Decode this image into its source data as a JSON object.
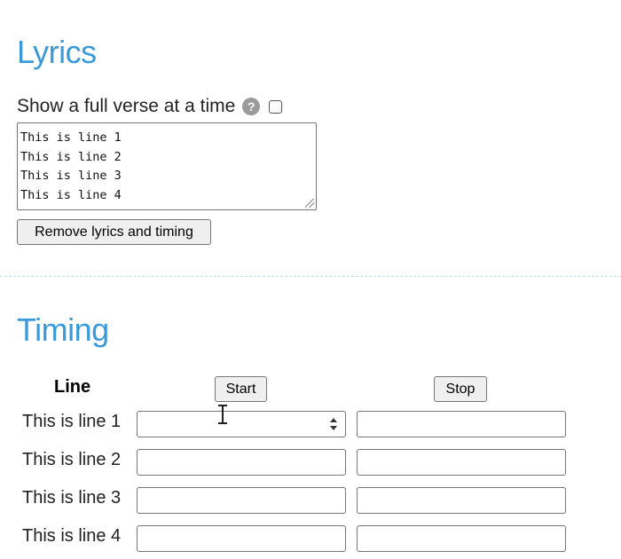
{
  "lyrics": {
    "title": "Lyrics",
    "full_verse_label": "Show a full verse at a time",
    "help_icon": "question-circle-icon",
    "full_verse_checked": false,
    "text_lines": [
      "This is line 1",
      "This is line 2",
      "This is line 3",
      "This is line 4"
    ],
    "remove_button_label": "Remove lyrics and timing"
  },
  "timing": {
    "title": "Timing",
    "col_line": "Line",
    "start_button_label": "Start",
    "stop_button_label": "Stop",
    "rows": [
      {
        "line": "This is line 1",
        "start": "",
        "stop": ""
      },
      {
        "line": "This is line 2",
        "start": "",
        "stop": ""
      },
      {
        "line": "This is line 3",
        "start": "",
        "stop": ""
      },
      {
        "line": "This is line 4",
        "start": "",
        "stop": ""
      }
    ]
  },
  "colors": {
    "heading": "#3a9ad9",
    "divider": "#b7dcf0"
  }
}
